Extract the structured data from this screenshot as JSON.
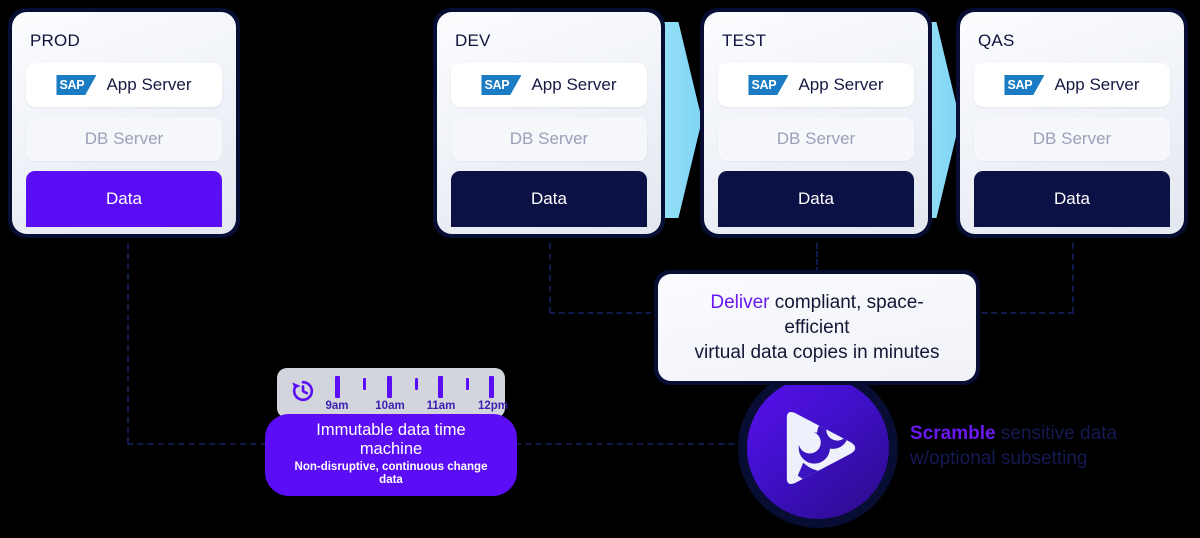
{
  "diagram": {
    "title": "SAP virtual data delivery pipeline",
    "colors": {
      "background": "#000000",
      "card_border": "#070d33",
      "accent_purple": "#5b0ef5",
      "deliver_accent": "#6a18f0",
      "chevron_blue": "#8fdcf7",
      "sap_blue": "#1b7cc4",
      "data_prod": "#5b0ef5",
      "data_copy": "#0c1145",
      "connector": "#111a4d",
      "tm_panel": "#d3d5dd"
    },
    "environments": [
      {
        "name": "PROD",
        "app_server_label": "App Server",
        "app_server_vendor": "SAP",
        "db_server_label": "DB Server",
        "data_label": "Data",
        "data_state": "source"
      },
      {
        "name": "DEV",
        "app_server_label": "App Server",
        "app_server_vendor": "SAP",
        "db_server_label": "DB Server",
        "data_label": "Data",
        "data_state": "copy"
      },
      {
        "name": "TEST",
        "app_server_label": "App Server",
        "app_server_vendor": "SAP",
        "db_server_label": "DB Server",
        "data_label": "Data",
        "data_state": "copy"
      },
      {
        "name": "QAS",
        "app_server_label": "App Server",
        "app_server_vendor": "SAP",
        "db_server_label": "DB Server",
        "data_label": "Data",
        "data_state": "copy"
      }
    ],
    "deliver_callout": {
      "accent_text": "Deliver",
      "rest_line1": " compliant, space-efficient",
      "line2": "virtual data copies in minutes"
    },
    "time_machine": {
      "icon": "clock-rewind-icon",
      "ticks": [
        {
          "type": "major",
          "label": "9am"
        },
        {
          "type": "minor",
          "label": ""
        },
        {
          "type": "major",
          "label": "10am"
        },
        {
          "type": "minor",
          "label": ""
        },
        {
          "type": "major",
          "label": "11am"
        },
        {
          "type": "minor",
          "label": ""
        },
        {
          "type": "major",
          "label": "12pm"
        }
      ],
      "pill_title": "Immutable data time machine",
      "pill_subtitle": "Non-disruptive, continuous change data"
    },
    "scramble": {
      "logo_name": "scramble-play-logo",
      "accent_text": "Scramble",
      "rest_line1": " sensitive data",
      "line2": "w/optional subsetting"
    }
  }
}
